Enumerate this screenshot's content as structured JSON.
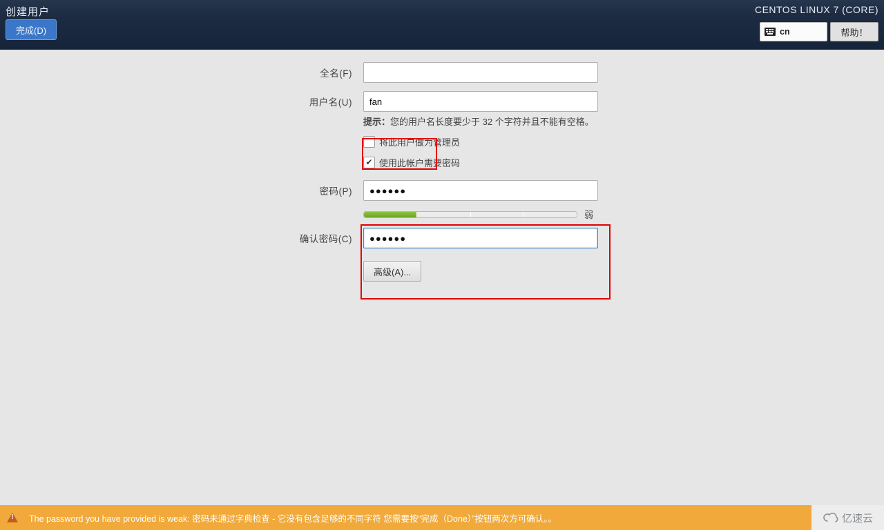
{
  "header": {
    "title": "创建用户",
    "done_button": "完成(D)",
    "os_label": "CENTOS LINUX 7 (CORE)",
    "keyboard_layout": "cn",
    "help_button": "帮助！"
  },
  "form": {
    "fullname_label": "全名(F)",
    "fullname_value": "",
    "username_label": "用户名(U)",
    "username_value": "fan",
    "username_hint_prefix": "提示：",
    "username_hint": "您的用户名长度要少于 32 个字符并且不能有空格。",
    "admin_checkbox_label": "将此用户做为管理员",
    "admin_checked": false,
    "require_password_label": "使用此帐户需要密码",
    "require_password_checked": true,
    "password_label": "密码(P)",
    "password_value": "●●●●●●",
    "confirm_label": "确认密码(C)",
    "confirm_value": "●●●●●●",
    "strength_label": "弱",
    "strength_segments": 4,
    "strength_filled": 1,
    "advanced_button": "高级(A)..."
  },
  "footer": {
    "warning": "The password you have provided is weak: 密码未通过字典检查 - 它没有包含足够的不同字符  您需要按“完成（Done）”按钮两次方可确认。。",
    "brand": "亿速云"
  }
}
